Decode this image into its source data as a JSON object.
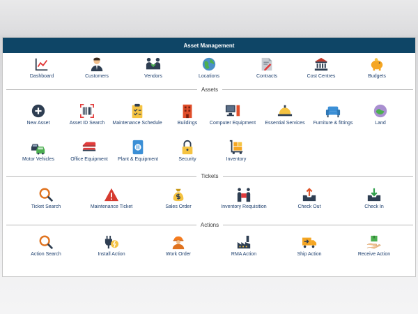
{
  "title": "Asset Management",
  "top_nav": [
    {
      "label": "Dashboard",
      "icon": "line-chart-icon"
    },
    {
      "label": "Customers",
      "icon": "person-icon"
    },
    {
      "label": "Vendors",
      "icon": "handshake-icon"
    },
    {
      "label": "Locations",
      "icon": "globe-icon"
    },
    {
      "label": "Contracts",
      "icon": "contract-icon"
    },
    {
      "label": "Cost Centres",
      "icon": "bank-icon"
    },
    {
      "label": "Budgets",
      "icon": "piggy-bank-icon"
    }
  ],
  "sections": {
    "assets": "Assets",
    "tickets": "Tickets",
    "actions": "Actions"
  },
  "assets_row1": [
    {
      "label": "New Asset",
      "icon": "plus-circle-icon"
    },
    {
      "label": "Asset ID Search",
      "icon": "barcode-icon"
    },
    {
      "label": "Maintenance Schedule",
      "icon": "clipboard-icon"
    },
    {
      "label": "Buildings",
      "icon": "building-icon"
    },
    {
      "label": "Computer Equipment",
      "icon": "computer-icon"
    },
    {
      "label": "Essential Services",
      "icon": "bell-icon"
    },
    {
      "label": "Furniture & fittings",
      "icon": "sofa-icon"
    },
    {
      "label": "Land",
      "icon": "land-icon"
    }
  ],
  "assets_row2": [
    {
      "label": "Motor Vehicles",
      "icon": "cars-icon"
    },
    {
      "label": "Office Equipment",
      "icon": "stapler-icon"
    },
    {
      "label": "Plant & Equipment",
      "icon": "plant-equipment-icon"
    },
    {
      "label": "Security",
      "icon": "padlock-icon"
    },
    {
      "label": "Inventory",
      "icon": "trolley-icon"
    }
  ],
  "tickets": [
    {
      "label": "Ticket Search",
      "icon": "magnifier-icon"
    },
    {
      "label": "Maintenance Ticket",
      "icon": "warning-icon"
    },
    {
      "label": "Sales Order",
      "icon": "money-bag-icon"
    },
    {
      "label": "Inventory Requisition",
      "icon": "people-box-icon"
    },
    {
      "label": "Check Out",
      "icon": "tray-out-icon"
    },
    {
      "label": "Check In",
      "icon": "tray-in-icon"
    }
  ],
  "actions": [
    {
      "label": "Action Search",
      "icon": "magnifier-icon"
    },
    {
      "label": "Install Action",
      "icon": "plug-icon"
    },
    {
      "label": "Work Order",
      "icon": "worker-icon"
    },
    {
      "label": "RMA Action",
      "icon": "factory-icon"
    },
    {
      "label": "Ship Action",
      "icon": "truck-icon"
    },
    {
      "label": "Receive Action",
      "icon": "receive-box-icon"
    }
  ],
  "colors": {
    "title_bar": "#0e4566",
    "label_text": "#1d3f6e"
  }
}
